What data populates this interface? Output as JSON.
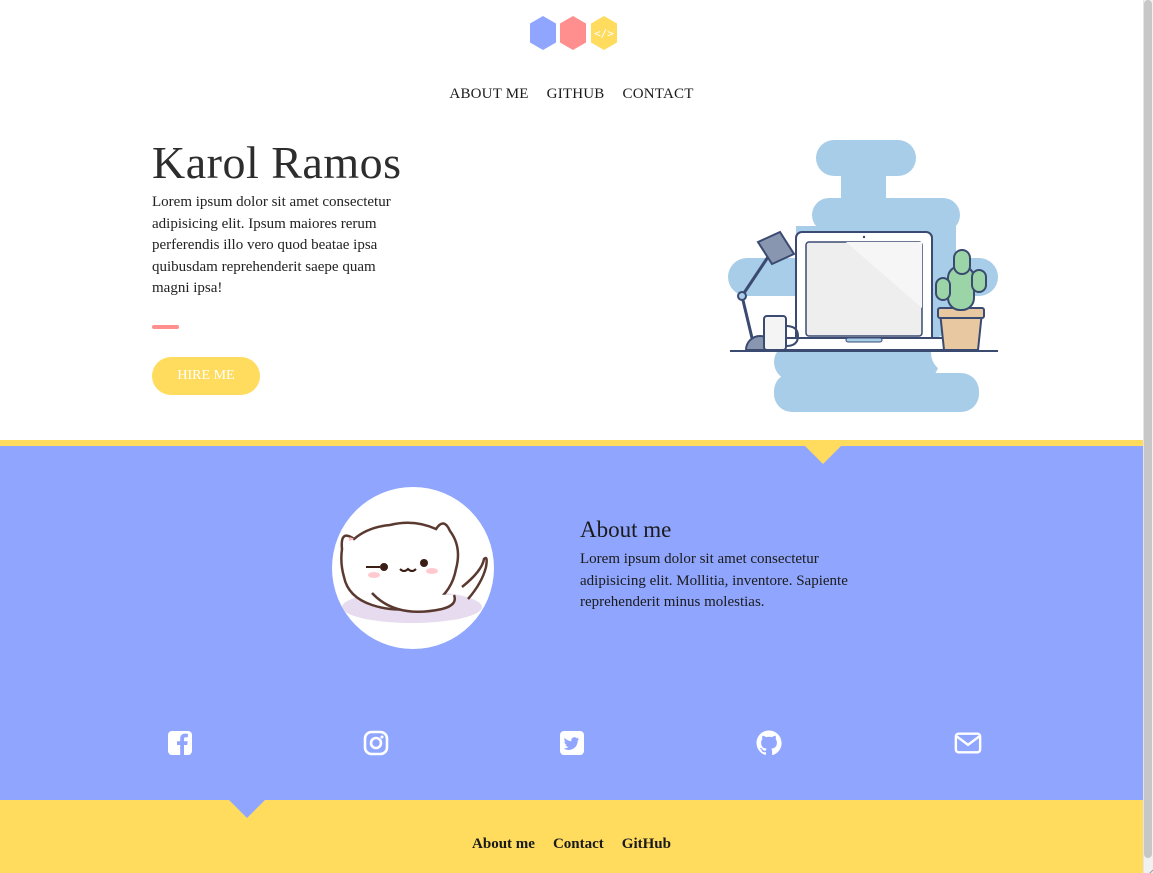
{
  "logo": {
    "icon": "hexagon-logo-icon",
    "colors": [
      "#8fa5fe",
      "#ff8f8f",
      "#ffdc5e"
    ],
    "glyph": "</>"
  },
  "nav": {
    "items": [
      {
        "label": "ABOUT ME"
      },
      {
        "label": "GITHUB"
      },
      {
        "label": "CONTACT"
      }
    ]
  },
  "hero": {
    "title": "Karol Ramos",
    "text": "Lorem ipsum dolor sit amet consectetur adipisicing elit. Ipsum maiores rerum perferendis illo vero quod beatae ipsa quibusdam reprehenderit saepe quam magni ipsa!",
    "button_label": "HIRE ME",
    "illustration_icon": "workspace-laptop-illustration"
  },
  "about": {
    "title": "About me",
    "text": "Lorem ipsum dolor sit amet consectetur adipisicing elit. Mollitia, inventore. Sapiente reprehenderit minus molestias.",
    "avatar_icon": "cat-avatar-illustration"
  },
  "social": [
    {
      "icon": "facebook-icon"
    },
    {
      "icon": "instagram-icon"
    },
    {
      "icon": "twitter-icon"
    },
    {
      "icon": "github-icon"
    },
    {
      "icon": "envelope-icon"
    }
  ],
  "footer": {
    "links": [
      {
        "label": "About me"
      },
      {
        "label": "Contact"
      },
      {
        "label": "GitHub"
      }
    ]
  },
  "colors": {
    "accent_yellow": "#ffdc5e",
    "accent_blue": "#8fa5fe",
    "accent_pink": "#ff8f8f"
  }
}
